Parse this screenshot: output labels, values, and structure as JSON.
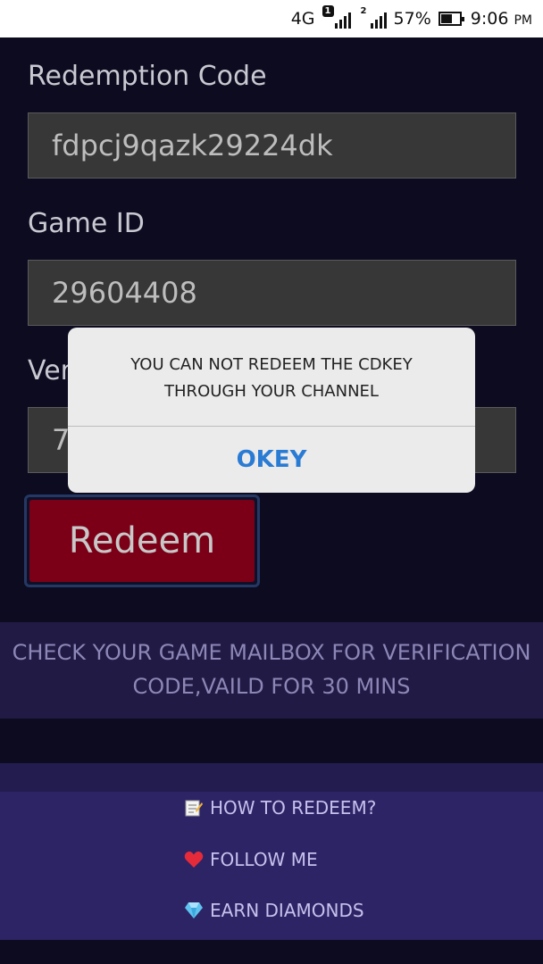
{
  "status_bar": {
    "network": "4G",
    "sim1": "1",
    "sim2": "2",
    "battery": "57%",
    "time": "9:06",
    "ampm": "PM"
  },
  "form": {
    "redemption_label": "Redemption Code",
    "redemption_value": "fdpcj9qazk29224dk",
    "game_id_label": "Game ID",
    "game_id_value": "29604408",
    "verification_label_visible": "Ver",
    "verification_value_visible": "7",
    "redeem_button": "Redeem"
  },
  "notice": {
    "line1": "CHECK YOUR GAME MAILBOX FOR VERIFICATION",
    "line2": "CODE,VAILD FOR 30 MINS"
  },
  "links": [
    {
      "icon": "memo-icon",
      "label": "HOW TO REDEEM?"
    },
    {
      "icon": "heart-icon",
      "label": "FOLLOW ME"
    },
    {
      "icon": "diamond-icon",
      "label": "EARN DIAMONDS"
    }
  ],
  "dialog": {
    "line1": "YOU CAN NOT REDEEM THE CDKEY",
    "line2": "THROUGH YOUR CHANNEL",
    "button": "OKEY"
  },
  "colors": {
    "background": "#0c0b20",
    "redeem_button": "#7b0017",
    "notice_band": "#201a44",
    "links_panel": "#2d2466",
    "dialog_accent": "#2a7bd4"
  }
}
